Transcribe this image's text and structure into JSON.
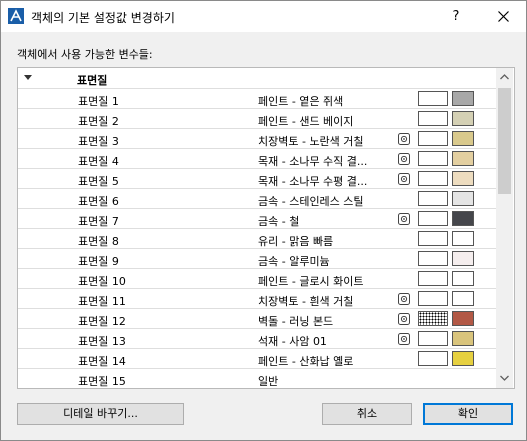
{
  "dialog": {
    "title": "객체의 기본 설정값 변경하기",
    "help_label": "?"
  },
  "variables_label": "객체에서 사용 가능한 변수들:",
  "list_header": {
    "label": "표면질"
  },
  "rows": [
    {
      "name": "표면질 1",
      "material": "페인트 - 옅은 쥐색",
      "texture": false,
      "color": "#a8a8a8"
    },
    {
      "name": "표면질 2",
      "material": "페인트 - 샌드 베이지",
      "texture": false,
      "color": "#d4d0b4"
    },
    {
      "name": "표면질 3",
      "material": "치장벽토 - 노란색 거칠",
      "texture": true,
      "color": "#d9c98c"
    },
    {
      "name": "표면질 4",
      "material": "목재 - 소나무 수직 결...",
      "texture": true,
      "color": "#e3cfa0"
    },
    {
      "name": "표면질 5",
      "material": "목재 - 소나무 수평 결...",
      "texture": true,
      "color": "#eddcbf"
    },
    {
      "name": "표면질 6",
      "material": "금속 - 스테인레스 스틸",
      "texture": false,
      "color": "#e4e4e4"
    },
    {
      "name": "표면질 7",
      "material": "금속 - 철",
      "texture": true,
      "color": "#45464b"
    },
    {
      "name": "표면질 8",
      "material": "유리 - 맑음 빠름",
      "texture": false,
      "color": "#ffffff"
    },
    {
      "name": "표면질 9",
      "material": "금속 - 알루미늄",
      "texture": false,
      "color": "#f5eeee"
    },
    {
      "name": "표면질 10",
      "material": "페인트 - 글로시 화이트",
      "texture": false,
      "color": "#ffffff"
    },
    {
      "name": "표면질 11",
      "material": "치장벽토 - 흰색 거칠",
      "texture": true,
      "color": "#ffffff"
    },
    {
      "name": "표면질 12",
      "material": "벽돌 - 러닝 본드",
      "texture": true,
      "color": "#b25845",
      "pattern": true
    },
    {
      "name": "표면질 13",
      "material": "석재 - 사암 01",
      "texture": true,
      "color": "#d9c47c"
    },
    {
      "name": "표면질 14",
      "material": "페인트 - 산화납 옐로",
      "texture": false,
      "color": "#e6d040"
    },
    {
      "name": "표면질 15",
      "material": "일반",
      "texture": false,
      "color": "#ffffff",
      "partial": true
    }
  ],
  "buttons": {
    "details": "디테일 바꾸기...",
    "cancel": "취소",
    "ok": "확인"
  },
  "accent_color": "#0078d7"
}
